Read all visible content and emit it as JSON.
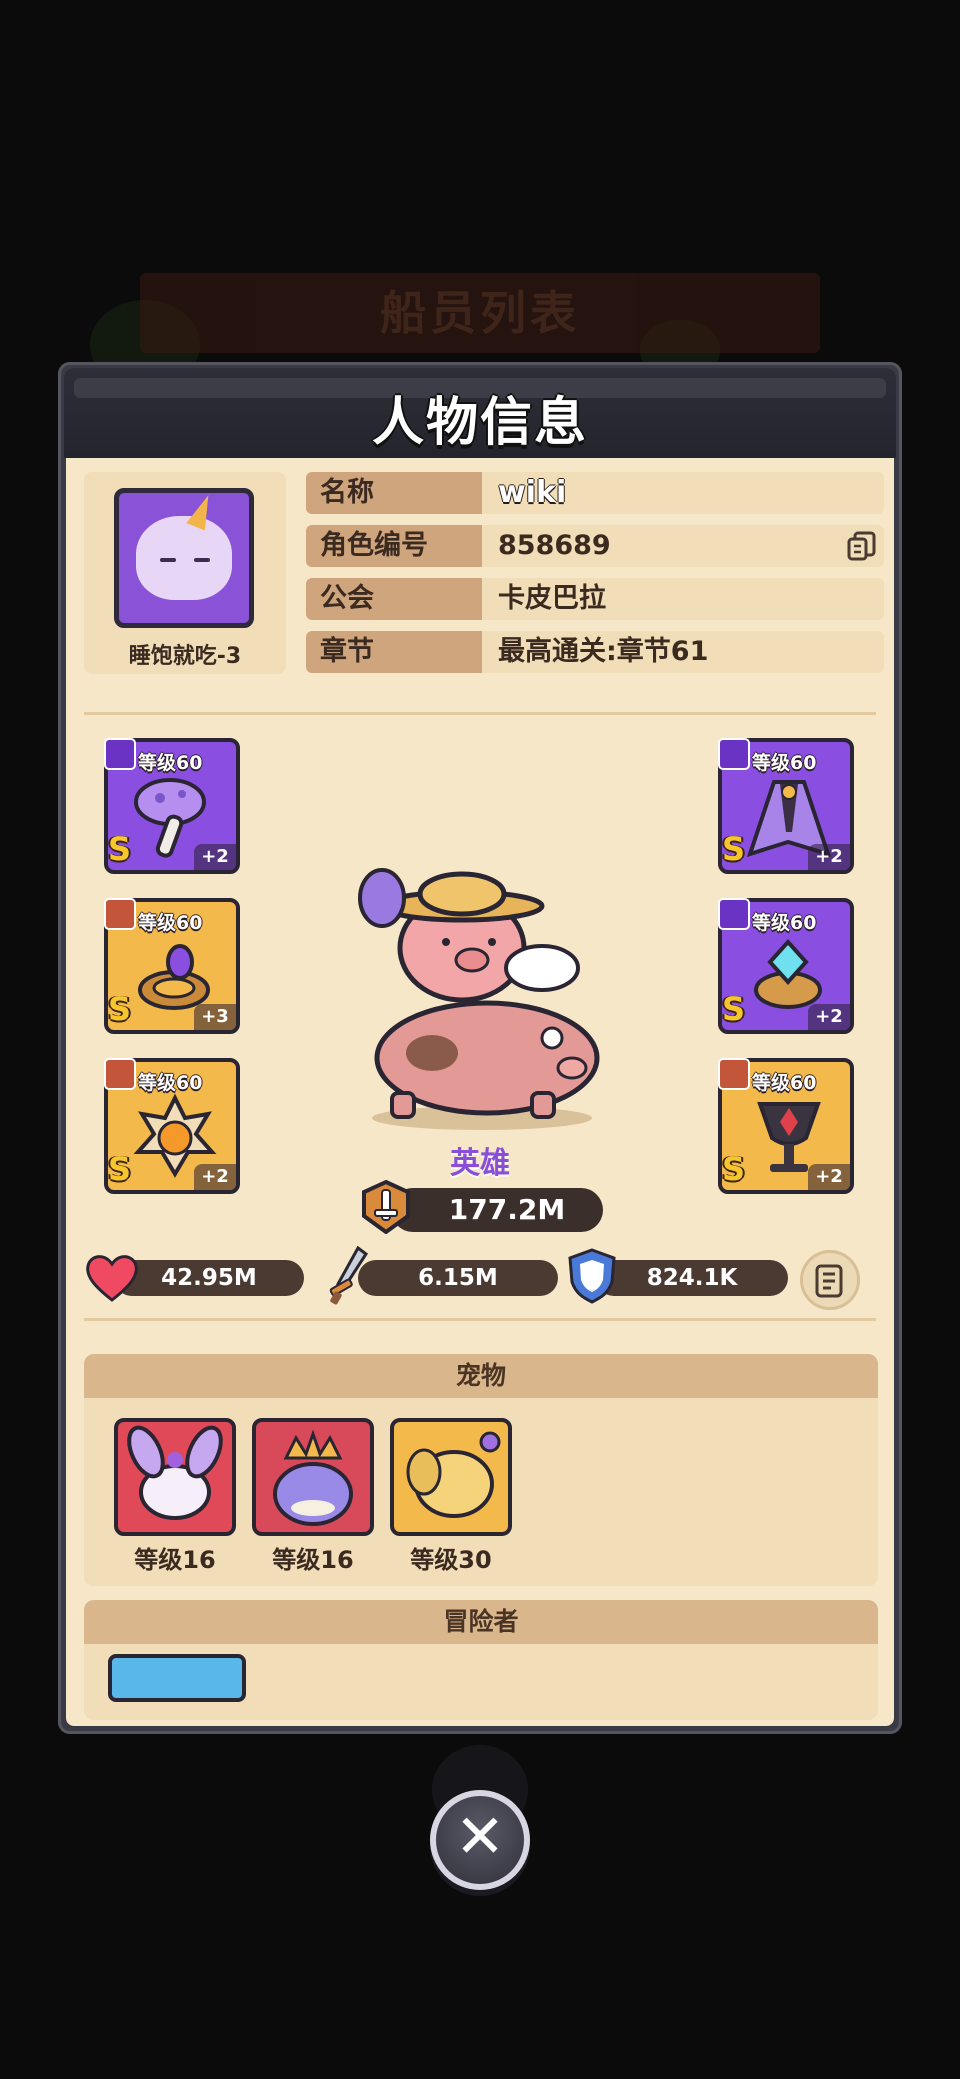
{
  "background": {
    "title": "船员列表"
  },
  "panel": {
    "title": "人物信息"
  },
  "profile": {
    "avatar_name": "睡饱就吃-3",
    "rows": [
      {
        "label": "名称",
        "value": "wiki"
      },
      {
        "label": "角色编号",
        "value": "858689"
      },
      {
        "label": "公会",
        "value": "卡皮巴拉"
      },
      {
        "label": "章节",
        "value": "最高通关:章节61"
      }
    ]
  },
  "equipment": {
    "left": [
      {
        "level": "等级60",
        "grade": "S",
        "plus": "+2",
        "rarity": "purple",
        "slot_icon": "sword-icon",
        "item_icon": "mushroom-axe-icon"
      },
      {
        "level": "等级60",
        "grade": "S",
        "plus": "+3",
        "rarity": "gold",
        "slot_icon": "ring-icon",
        "item_icon": "gem-ring-icon"
      },
      {
        "level": "等级60",
        "grade": "S",
        "plus": "+2",
        "rarity": "gold",
        "slot_icon": "necklace-icon",
        "item_icon": "sun-amulet-icon"
      }
    ],
    "right": [
      {
        "level": "等级60",
        "grade": "S",
        "plus": "+2",
        "rarity": "purple",
        "slot_icon": "armor-icon",
        "item_icon": "cloak-icon"
      },
      {
        "level": "等级60",
        "grade": "S",
        "plus": "+2",
        "rarity": "purple",
        "slot_icon": "ring-icon",
        "item_icon": "crystal-ring-icon"
      },
      {
        "level": "等级60",
        "grade": "S",
        "plus": "+2",
        "rarity": "gold",
        "slot_icon": "necklace-icon",
        "item_icon": "chalice-icon"
      }
    ]
  },
  "hero": {
    "class": "英雄",
    "power": "177.2M"
  },
  "stats": {
    "hp": "42.95M",
    "attack": "6.15M",
    "defense": "824.1K"
  },
  "pets": {
    "title": "宠物",
    "items": [
      {
        "level": "等级16",
        "color": "#e04a58"
      },
      {
        "level": "等级16",
        "color": "#d84a5a"
      },
      {
        "level": "等级30",
        "color": "#f3b94a"
      }
    ]
  },
  "adventurers": {
    "title": "冒险者"
  },
  "colors": {
    "purple": "#8a4fe0",
    "gold": "#f3b94a",
    "panel_bg": "#f6e7c9",
    "header": "#2e2e38"
  }
}
